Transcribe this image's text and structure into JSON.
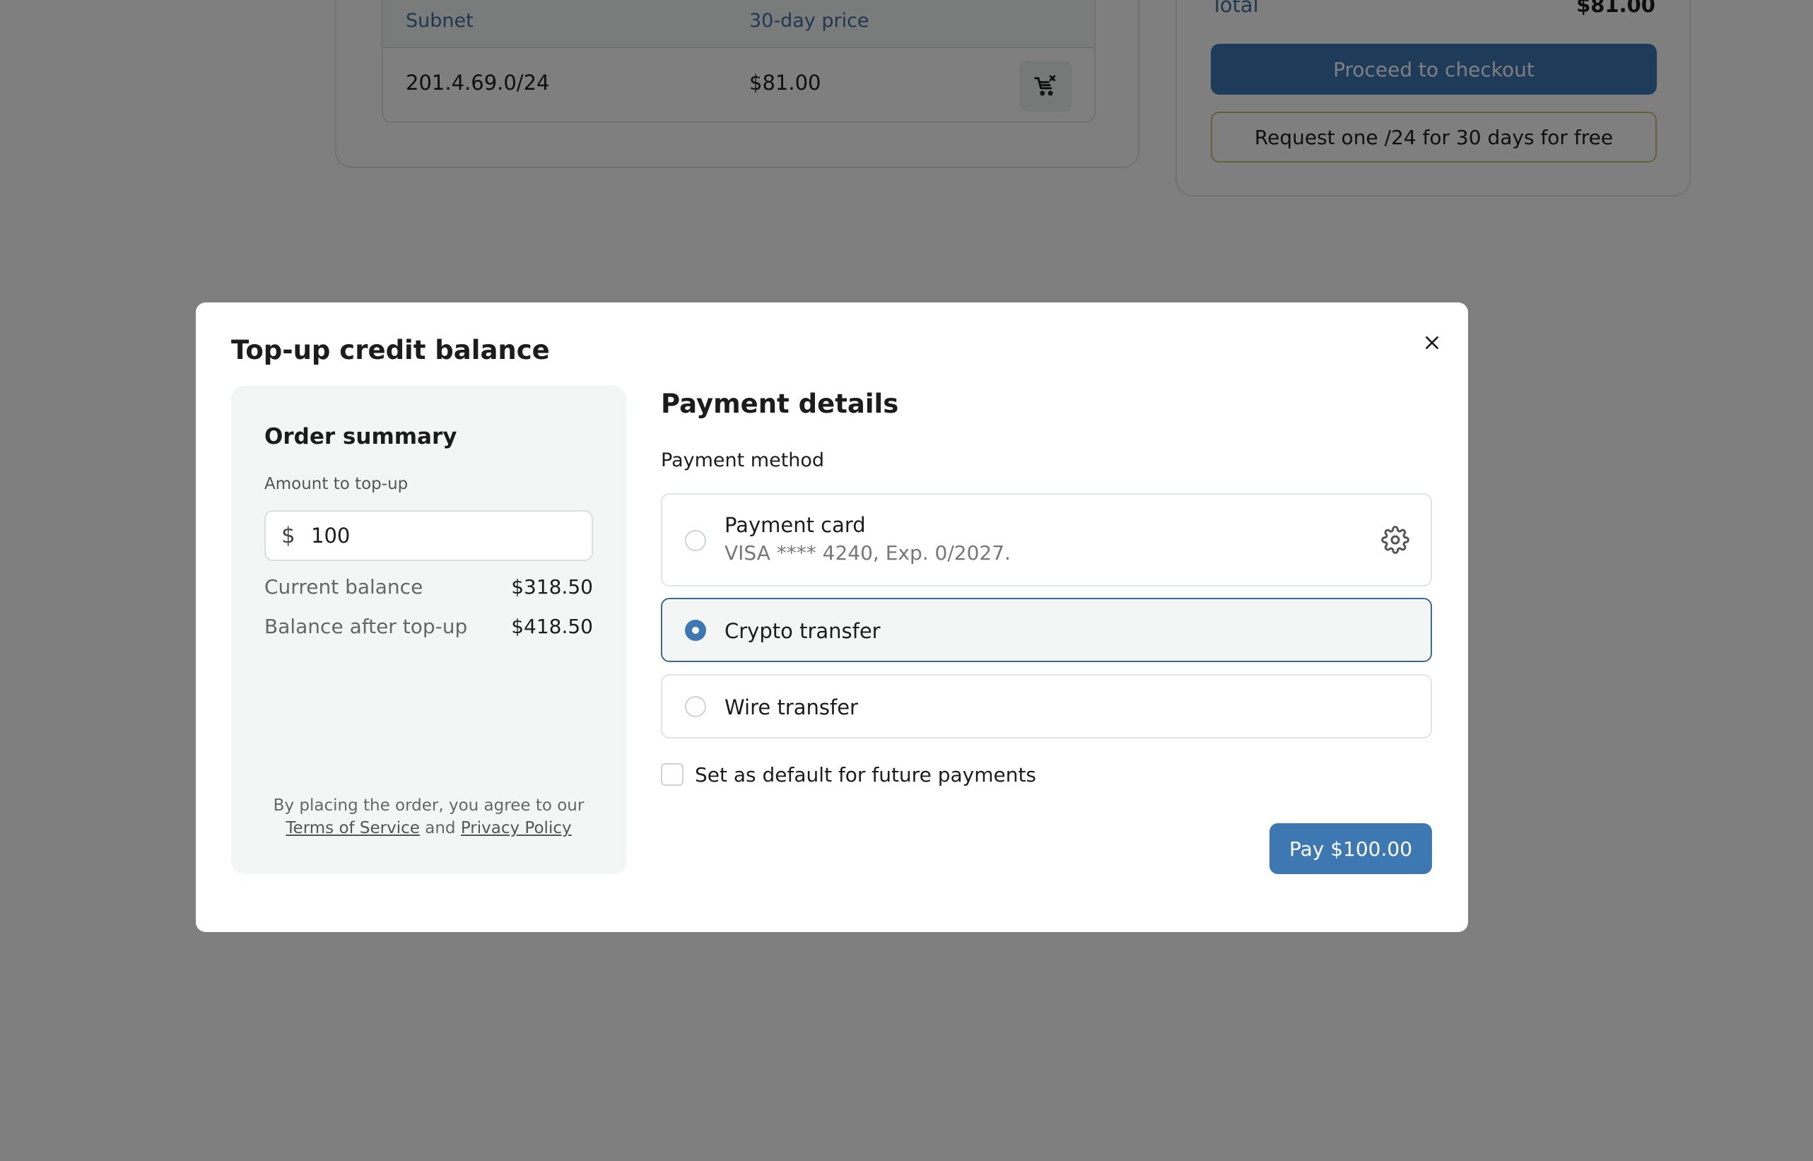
{
  "background": {
    "table": {
      "col_subnet": "Subnet",
      "col_price": "30-day price",
      "row": {
        "subnet": "201.4.69.0/24",
        "price": "$81.00"
      }
    },
    "total": {
      "label": "Total",
      "value": "$81.00"
    },
    "checkout_label": "Proceed to checkout",
    "free_request_label": "Request one /24 for 30 days for free"
  },
  "modal": {
    "title": "Top-up credit balance",
    "summary": {
      "title": "Order summary",
      "amount_label": "Amount to top-up",
      "currency_symbol": "$",
      "amount_value": "100",
      "current_balance_label": "Current balance",
      "current_balance_value": "$318.50",
      "after_label": "Balance after top-up",
      "after_value": "$418.50",
      "terms_prefix": "By placing the order, you agree to our",
      "terms_link": "Terms of Service",
      "terms_and": "and",
      "privacy_link": "Privacy Policy"
    },
    "payment": {
      "title": "Payment details",
      "method_label": "Payment method",
      "options": [
        {
          "title": "Payment card",
          "subtitle": "VISA **** 4240, Exp. 0/2027.",
          "selected": false
        },
        {
          "title": "Crypto transfer",
          "selected": true
        },
        {
          "title": "Wire transfer",
          "selected": false
        }
      ],
      "default_label": "Set as default for future payments",
      "default_checked": false,
      "pay_label": "Pay $100.00"
    }
  },
  "colors": {
    "accent": "#3d78b3",
    "selected_border": "#3d6a93",
    "free_border": "#c9c26e"
  }
}
